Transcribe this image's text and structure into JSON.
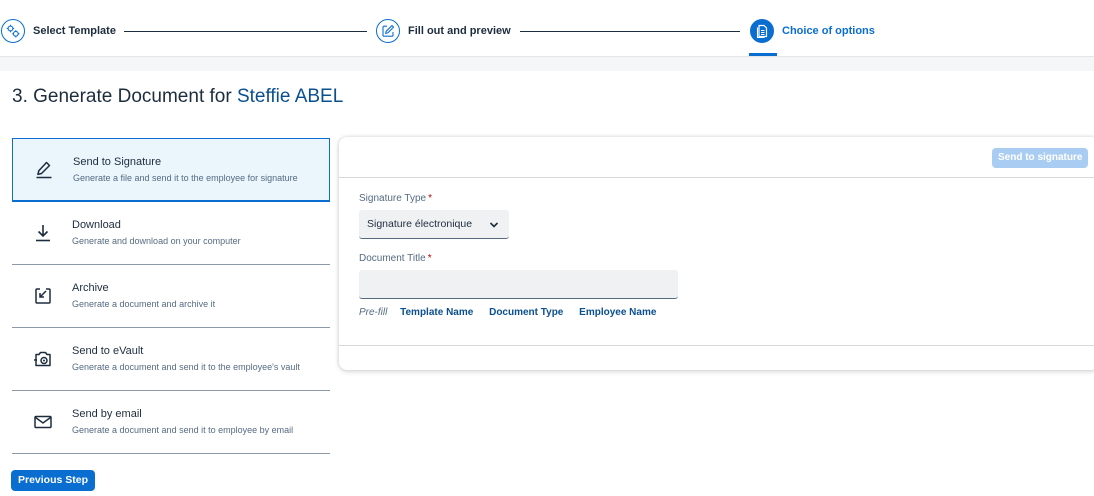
{
  "wizard": {
    "steps": [
      {
        "label": "Select Template",
        "icon": "template-settings-icon",
        "state": "done"
      },
      {
        "label": "Fill out and preview",
        "icon": "edit-document-icon",
        "state": "done"
      },
      {
        "label": "Choice of options",
        "icon": "document-icon",
        "state": "active"
      }
    ]
  },
  "page": {
    "title_prefix": "3. Generate Document for",
    "employee_name": "Steffie ABEL"
  },
  "options": [
    {
      "title": "Send to Signature",
      "description": "Generate a file and send it to the employee for signature",
      "icon": "signature-pen-icon",
      "selected": true
    },
    {
      "title": "Download",
      "description": "Generate and download on your computer",
      "icon": "download-icon",
      "selected": false
    },
    {
      "title": "Archive",
      "description": "Generate a document and archive it",
      "icon": "archive-icon",
      "selected": false
    },
    {
      "title": "Send to eVault",
      "description": "Generate a document and send it to the employee's vault",
      "icon": "evault-icon",
      "selected": false
    },
    {
      "title": "Send by email",
      "description": "Generate a document and send it to employee by email",
      "icon": "email-icon",
      "selected": false
    }
  ],
  "footer": {
    "previous_step_label": "Previous Step"
  },
  "panel": {
    "send_button_label": "Send to signature",
    "send_button_enabled": false,
    "signature_type": {
      "label": "Signature Type",
      "required_marker": "*",
      "value": "Signature électronique"
    },
    "document_title": {
      "label": "Document Title",
      "required_marker": "*",
      "value": "",
      "placeholder": ""
    },
    "prefill": {
      "label": "Pre-fill",
      "links": [
        "Template Name",
        "Document Type",
        "Employee Name"
      ]
    }
  },
  "colors": {
    "accent": "#0a6ed1",
    "link": "#0a4f8f",
    "selected_bg": "#eaf5fc",
    "required": "#bb0000",
    "disabled_button": "#a9cdf2"
  }
}
